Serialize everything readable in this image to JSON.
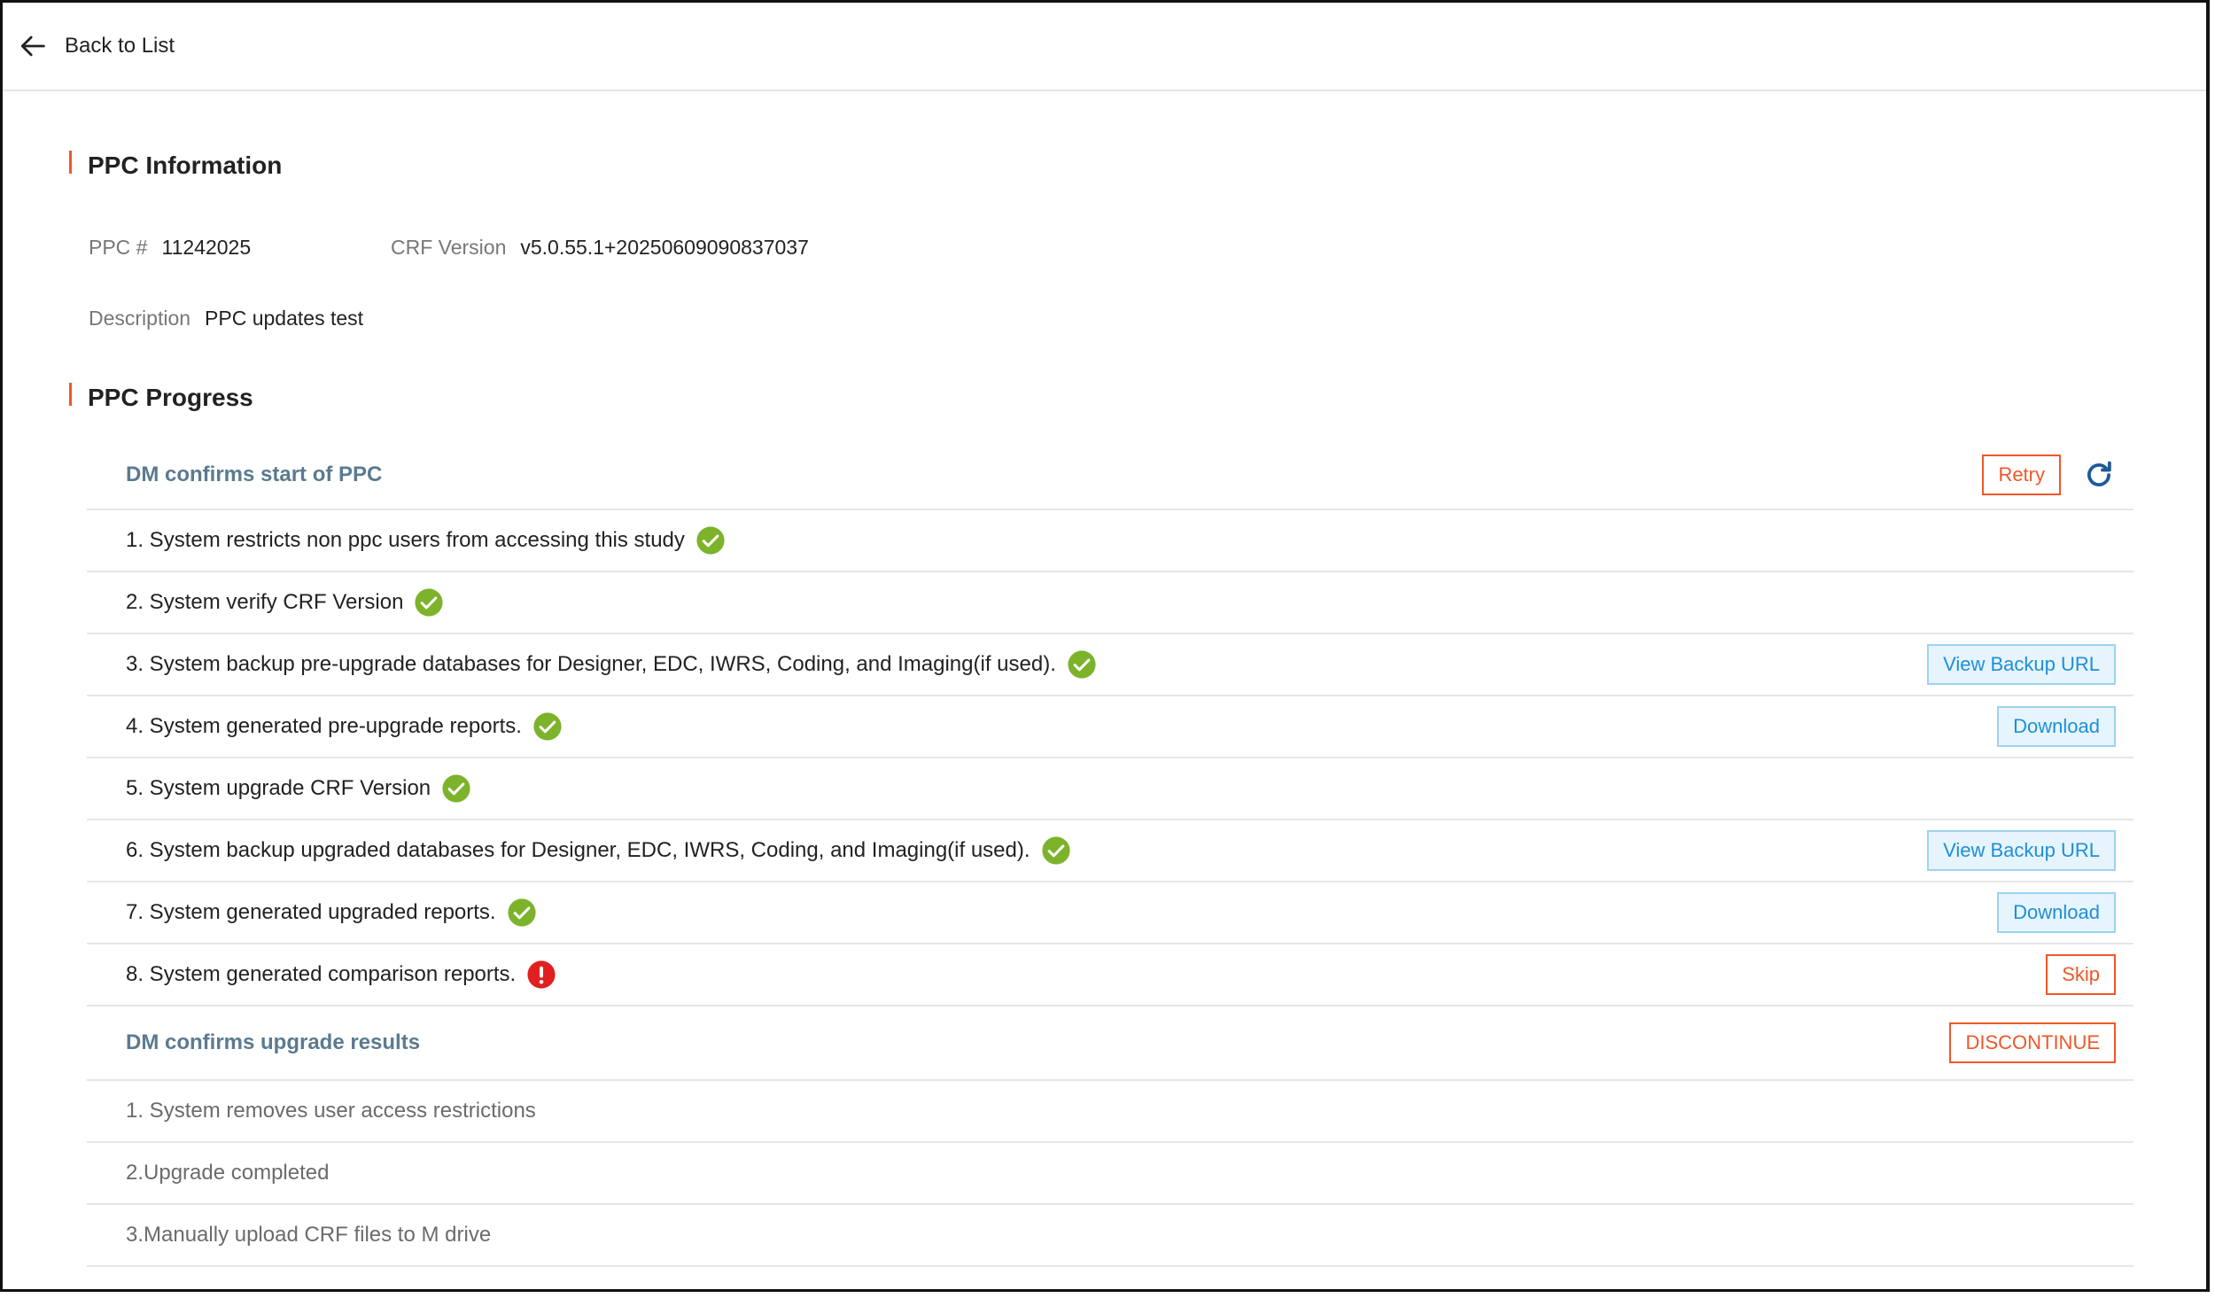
{
  "nav": {
    "back_label": "Back to List"
  },
  "info": {
    "title": "PPC Information",
    "ppc_label": "PPC #",
    "ppc_value": "11242025",
    "crf_label": "CRF Version",
    "crf_value": "v5.0.55.1+20250609090837037",
    "desc_label": "Description",
    "desc_value": "PPC updates test"
  },
  "progress": {
    "title": "PPC Progress",
    "group1": {
      "title": "DM confirms start of PPC",
      "retry_label": "Retry",
      "steps": [
        {
          "text": "1. System restricts non ppc users from accessing this study",
          "status": "success"
        },
        {
          "text": "2. System verify CRF Version",
          "status": "success"
        },
        {
          "text": "3. System backup pre-upgrade databases for Designer, EDC, IWRS, Coding, and Imaging(if used).",
          "status": "success",
          "action": "View Backup URL"
        },
        {
          "text": "4. System generated pre-upgrade reports.",
          "status": "success",
          "action": "Download"
        },
        {
          "text": "5. System upgrade CRF Version",
          "status": "success"
        },
        {
          "text": "6. System backup upgraded databases for Designer, EDC, IWRS, Coding, and Imaging(if used).",
          "status": "success",
          "action": "View Backup URL"
        },
        {
          "text": "7. System generated upgraded reports.",
          "status": "success",
          "action": "Download"
        },
        {
          "text": "8. System generated comparison reports.",
          "status": "error",
          "action": "Skip"
        }
      ]
    },
    "group2": {
      "title": "DM confirms upgrade results",
      "discontinue_label": "DISCONTINUE",
      "steps": [
        {
          "text": "1. System removes user access restrictions"
        },
        {
          "text": "2.Upgrade completed"
        },
        {
          "text": "3.Manually upload CRF files to M drive"
        }
      ]
    }
  },
  "colors": {
    "accent": "#f0572a",
    "success": "#7cb32a",
    "error": "#e02020",
    "link": "#1f8ed8",
    "group_title": "#5b7a90"
  },
  "icons": {
    "back": "arrow-left-icon",
    "success": "check-circle-icon",
    "error": "exclamation-circle-icon",
    "refresh": "refresh-icon"
  }
}
